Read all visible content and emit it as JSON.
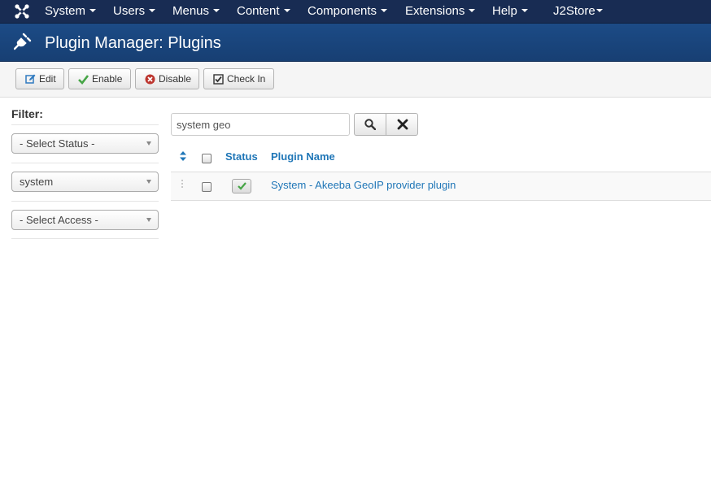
{
  "nav": {
    "items": [
      {
        "label": "System"
      },
      {
        "label": "Users"
      },
      {
        "label": "Menus"
      },
      {
        "label": "Content"
      },
      {
        "label": "Components"
      },
      {
        "label": "Extensions"
      },
      {
        "label": "Help"
      },
      {
        "label": "J2Store"
      }
    ],
    "logo_icon": "joomla-logo-icon"
  },
  "header": {
    "title": "Plugin Manager: Plugins",
    "icon": "plug-icon"
  },
  "toolbar": {
    "edit_label": "Edit",
    "enable_label": "Enable",
    "disable_label": "Disable",
    "checkin_label": "Check In"
  },
  "sidebar": {
    "filter_label": "Filter:",
    "status_select": "- Select Status -",
    "folder_select": "system",
    "access_select": "- Select Access -"
  },
  "search": {
    "value": "system geo"
  },
  "table": {
    "columns": {
      "status": "Status",
      "name": "Plugin Name"
    },
    "rows": [
      {
        "status": "enabled",
        "name": "System - Akeeba GeoIP provider plugin"
      }
    ]
  },
  "colors": {
    "navbar": "#182c53",
    "header": "#1c4b86",
    "link": "#1f76b7",
    "enabled_check": "#46a546",
    "disable_icon": "#bd362f"
  }
}
